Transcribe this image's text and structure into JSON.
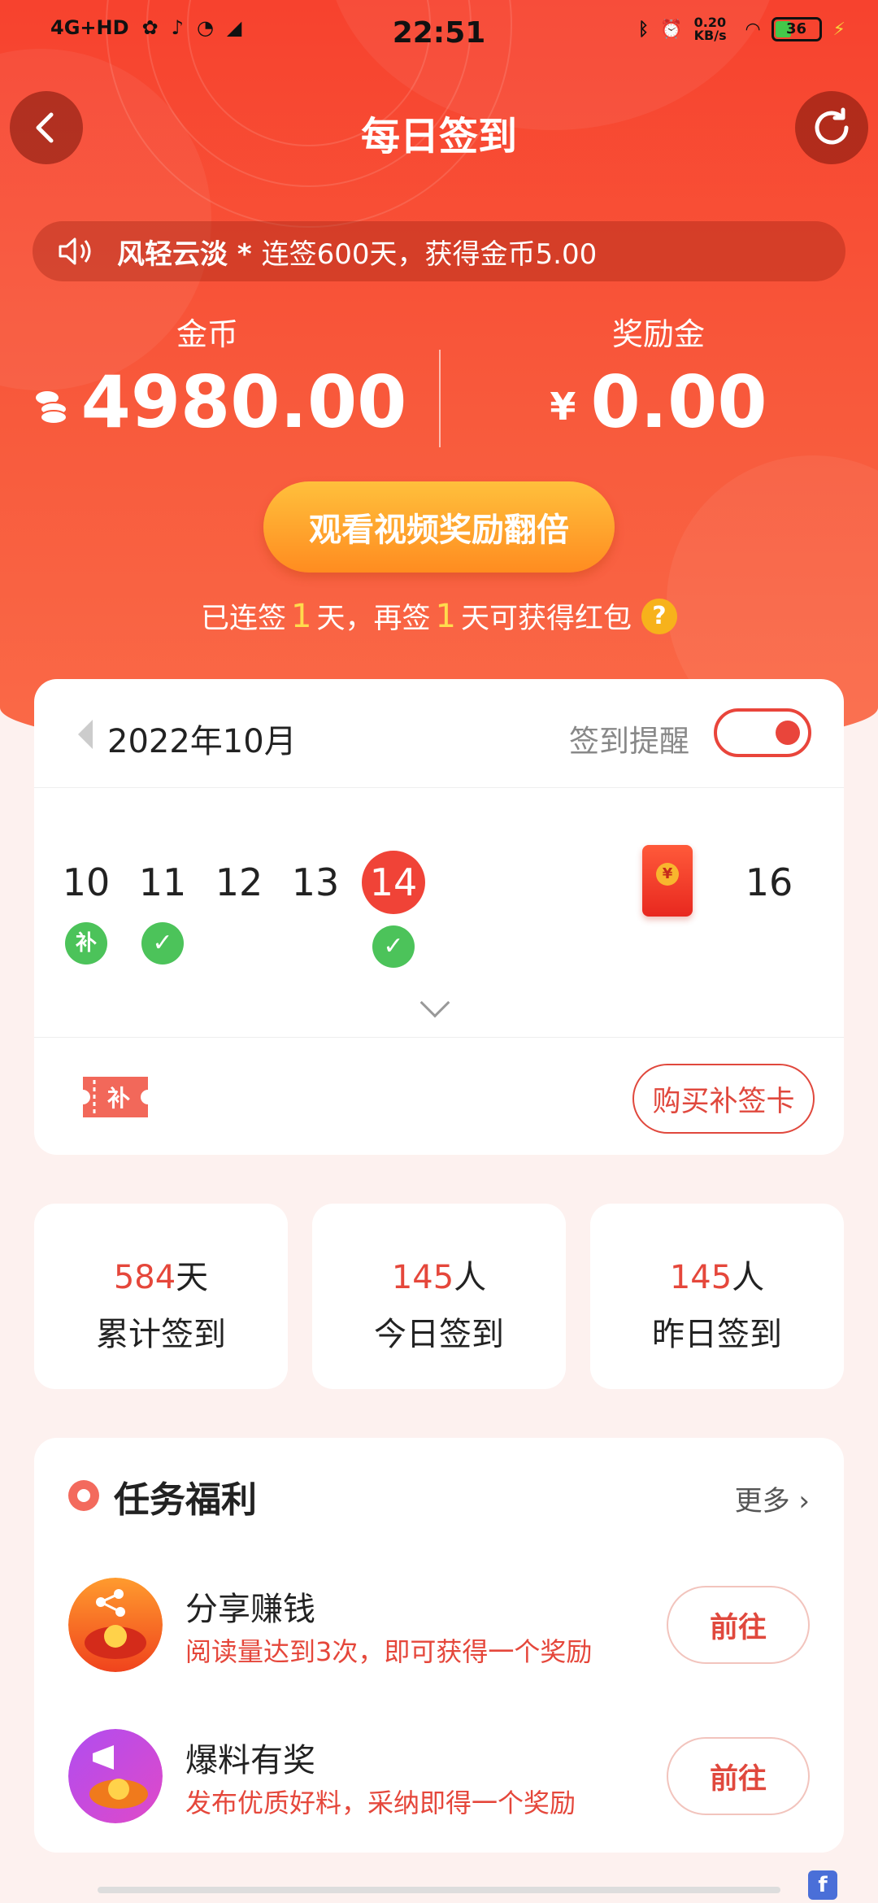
{
  "status_bar": {
    "network": "4G+HD",
    "time": "22:51",
    "speed": "0.20 KB/s",
    "battery": "36"
  },
  "header": {
    "title": "每日签到"
  },
  "marquee": {
    "user": "风轻云淡 *",
    "text": "连签600天，获得金币5.00"
  },
  "balances": {
    "coins_label": "金币",
    "coins_value": "4980.00",
    "reward_label": "奖励金",
    "reward_currency": "¥",
    "reward_value": "0.00"
  },
  "watch_button": "观看视频奖励翻倍",
  "streak": {
    "prefix": "已连签",
    "days": "1",
    "middle": "天，再签",
    "days2": "1",
    "suffix": "天可获得红包"
  },
  "calendar": {
    "month": "2022年10月",
    "remind_label": "签到提醒",
    "remind_on": true,
    "days": [
      {
        "num": "10",
        "mark": "补"
      },
      {
        "num": "11",
        "mark": "✓"
      },
      {
        "num": "12",
        "mark": ""
      },
      {
        "num": "13",
        "mark": ""
      },
      {
        "num": "14",
        "mark": "✓",
        "today": true
      },
      {
        "num": "",
        "mark": "",
        "redpacket": true
      },
      {
        "num": "16",
        "mark": ""
      }
    ],
    "card_icon_label": "补",
    "buy_button": "购买补签卡"
  },
  "stats": [
    {
      "value": "584",
      "unit": "天",
      "label": "累计签到"
    },
    {
      "value": "145",
      "unit": "人",
      "label": "今日签到"
    },
    {
      "value": "145",
      "unit": "人",
      "label": "昨日签到"
    }
  ],
  "tasks": {
    "title": "任务福利",
    "more": "更多",
    "items": [
      {
        "name": "分享赚钱",
        "desc": "阅读量达到3次，即可获得一个奖励",
        "button": "前往"
      },
      {
        "name": "爆料有奖",
        "desc": "发布优质好料，采纳即得一个奖励",
        "button": "前往"
      }
    ]
  },
  "colors": {
    "brand": "#f7422e",
    "accent": "#e5473b",
    "button_gold": "#ffa52e",
    "check_green": "#4cc35a"
  }
}
